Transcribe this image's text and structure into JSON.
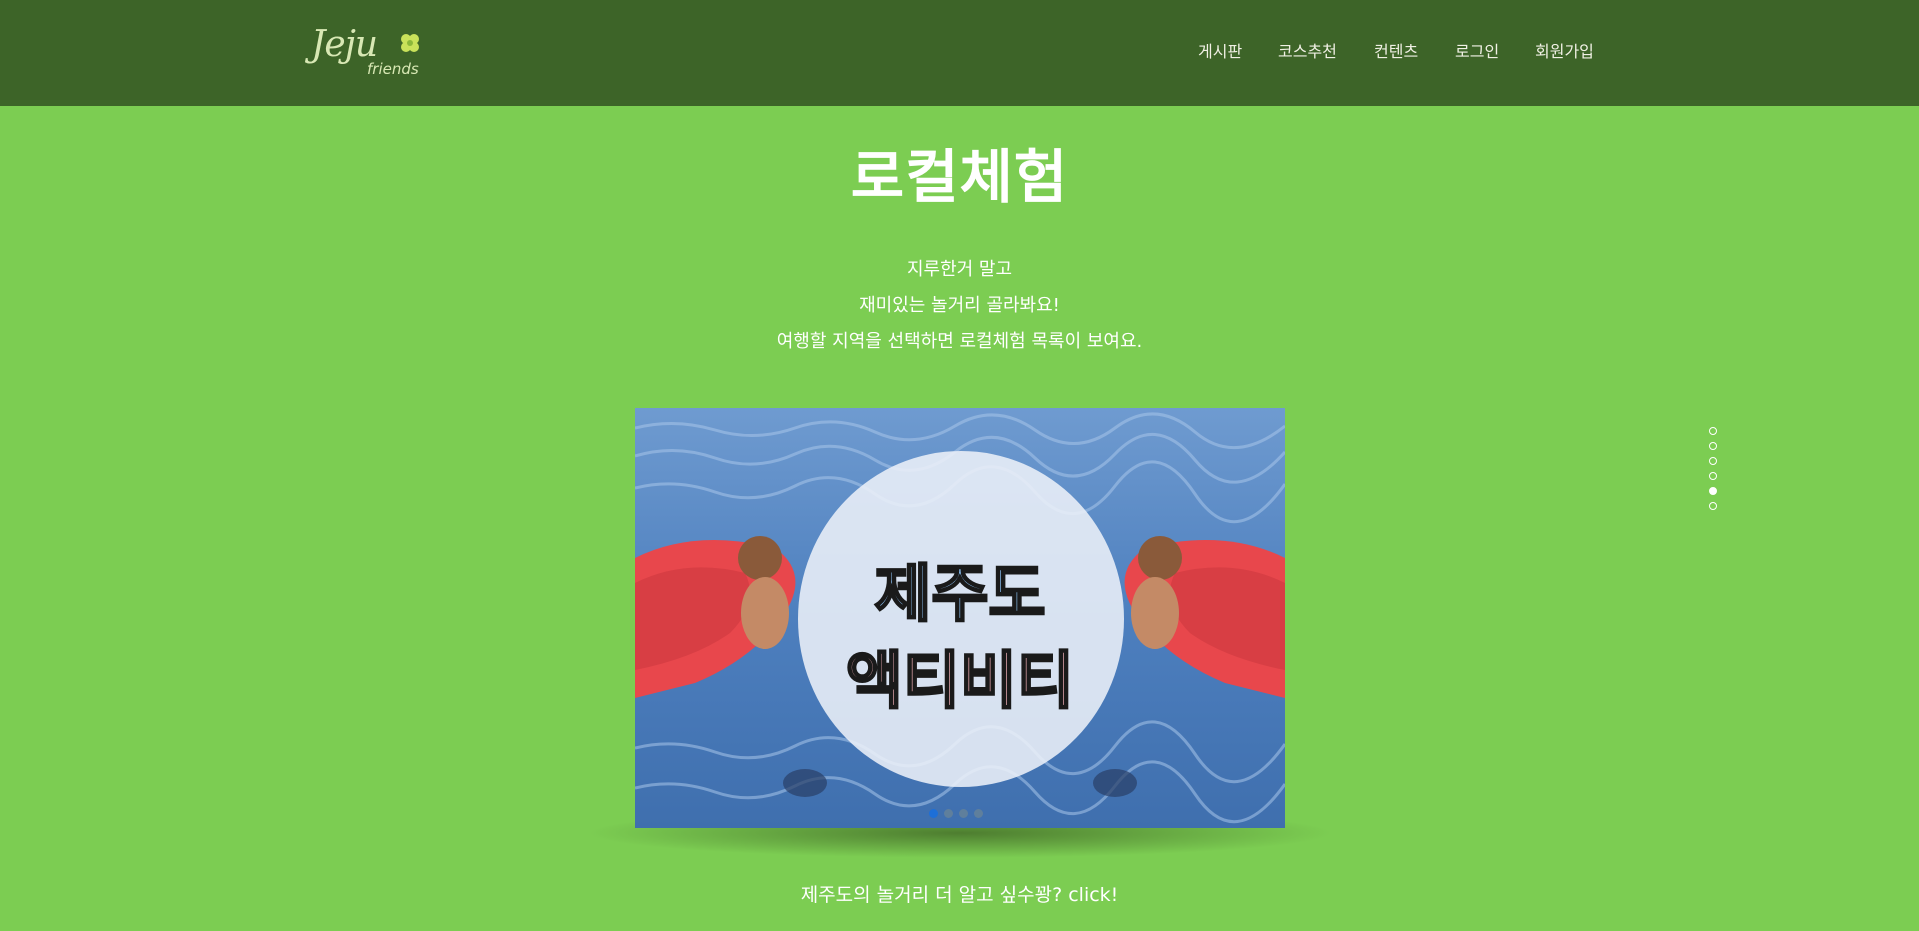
{
  "header": {
    "logo": {
      "main": "Jeju",
      "sub": "friends"
    },
    "nav": [
      "게시판",
      "코스추천",
      "컨텐츠",
      "로그인",
      "회원가입"
    ]
  },
  "main": {
    "title": "로컬체험",
    "description": [
      "지루한거 말고",
      "재미있는 놀거리 골라봐요!",
      "여행할 지역을 선택하면 로컬체험 목록이 보여요."
    ],
    "slider": {
      "line1": "제주도",
      "line2": "액티비티",
      "dots": 4,
      "active_dot": 0
    },
    "more_link": "제주도의 놀거리 더 알고 싶수꽝? click!"
  },
  "section_nav": {
    "count": 6,
    "active": 4
  },
  "colors": {
    "header_bg": "#3d6428",
    "page_bg": "#7ccd52",
    "slider_active_dot": "#1d6fd8"
  }
}
